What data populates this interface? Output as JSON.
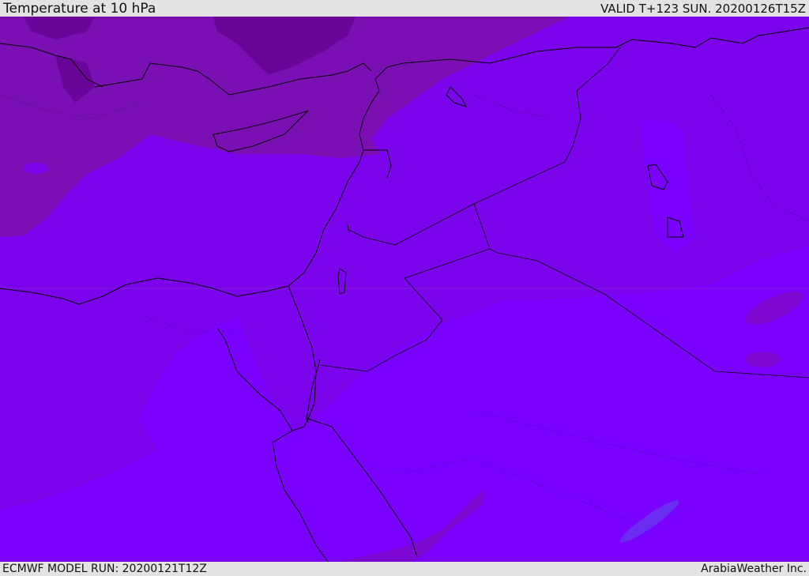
{
  "header": {
    "title": "Temperature at 10 hPa",
    "valid_time": "VALID T+123 SUN. 20200126T15Z"
  },
  "footer": {
    "model_run": "ECMWF MODEL RUN: 20200121T12Z",
    "credit": "ArabiaWeather Inc."
  },
  "map": {
    "field": "temperature",
    "level": "10 hPa",
    "region": "Eastern Mediterranean / Middle East",
    "colors": {
      "darkest": "#6a0599",
      "dark": "#7a10b4",
      "mid": "#7c08d2",
      "light": "#7b04ec",
      "lightest": "#7a00ff",
      "cool_patch": "#6a2cf0",
      "coastline": "#000000"
    }
  }
}
